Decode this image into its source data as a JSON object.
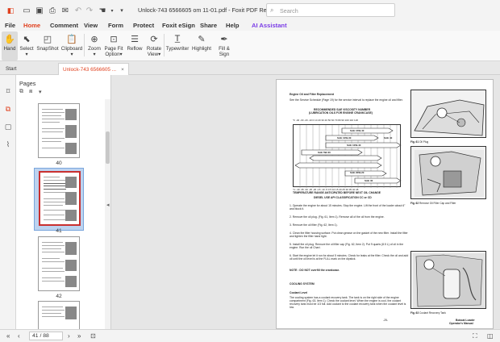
{
  "app": {
    "title": "Unlock-743 6566605 om 11-01.pdf - Foxit PDF Reader",
    "search_placeholder": "Search",
    "brand_color": "#e0401e",
    "ai_color": "#7a3ce6"
  },
  "menu": {
    "file": "File",
    "home": "Home",
    "comment": "Comment",
    "view": "View",
    "form": "Form",
    "protect": "Protect",
    "esign": "Foxit eSign",
    "share": "Share",
    "help": "Help",
    "ai": "AI Assistant"
  },
  "ribbon": {
    "hand": "Hand",
    "select": "Select",
    "snapshot": "SnapShot",
    "clipboard": "Clipboard",
    "zoom": "Zoom",
    "page_fit": "Page Fit",
    "option": "Option",
    "reflow": "Reflow",
    "rotate": "Rotate",
    "view": "View",
    "typewriter": "Typewriter",
    "highlight": "Highlight",
    "fill": "Fill &",
    "sign": "Sign"
  },
  "tabs": {
    "start": "Start",
    "doc": "Unlock-743 6566605 ...",
    "close": "×"
  },
  "pages_panel": {
    "title": "Pages",
    "thumbs": [
      {
        "number": "40"
      },
      {
        "number": "41"
      },
      {
        "number": "42"
      }
    ]
  },
  "document": {
    "section1": "Engine Oil and Filter Replacement",
    "intro_line1": "See the Service Schedule (Page 19) for the service interval to replace the engine oil",
    "intro_line2": "and filter.",
    "chart_title1": "RECOMMENDED SAE VISCOSITY NUMBER",
    "chart_title2": "(LUBRICATION OILS FOR ENGINE CRANKCASE)",
    "chart_f": "°F -40 -30 -20 -10 0 10 20 30 40 50 60 70 80 90 100 110 120",
    "chart_c": "°C -40 -35 -30 -25 -20 -15 -10 -5 0 5 10 15 20 25 30 35 40 45",
    "chart_foot1": "TEMPERATURE RANGE ANTICIPATED BEFORE NEXT OIL CHANGE",
    "chart_foot2": "DIESEL USE API CLASSIFICATION CC or CD",
    "sae_labels": [
      "SAE 15W-40",
      "SAE 10W-30",
      "SAE 10W-40",
      "SAE 5W-30",
      "SAE 20W-20",
      "SAE 30",
      "SAE 40"
    ],
    "steps": [
      "1. Operate the engine for about 15 minutes. Stop the engine. Lift the front of the loader about 6\" and block it.",
      "2. Remove the oil plug. (Fig. 61, Item 1). Remove all of the oil from the engine.",
      "3. Remove the oil filter (Fig. 62, Item 1).",
      "4. Clean the filter housing surface. Put clean grease on the gasket of the new filter. Install the filter and tighten the filter hand tight.",
      "5. Install the oil plug. Remove the oil filler cap (Fig. 62, Item 2). Put 9 quarts (8.5 L) of oil in the engine. Run the oil Chart.",
      "6. Start the engine let it run for about 5 minutes. Check for leaks at the filter. Check the oil and add oil until the oil level is at the FULL mark on the dipstick."
    ],
    "note": "NOTE : DO NOT overfill the crankcase.",
    "section2": "COOLING SYSTEM",
    "coolant_heading": "Coolant Level",
    "coolant_text": "The cooling system has a coolant recovery tank. The tank is on the right side of the engine compartment (Fig. 63, Item 1). Check the coolant level. When the engine is cool, the coolant recovery tank must be 1/3 full. Add coolant to the coolant recovery tank when the coolant level is low.",
    "fig61": "Fig. 61",
    "fig61_cap": "Oil Plug",
    "fig62": "Fig. 62",
    "fig62_cap": "Remove Oil Filler Cap and Filter",
    "fig63": "Fig. 63",
    "fig63_cap": "Coolant Recovery Tank",
    "page_no": "-25-",
    "footer1": "Bobcat Loader",
    "footer2": "Operator's Manual"
  },
  "status": {
    "page_box": "41 / 88"
  }
}
